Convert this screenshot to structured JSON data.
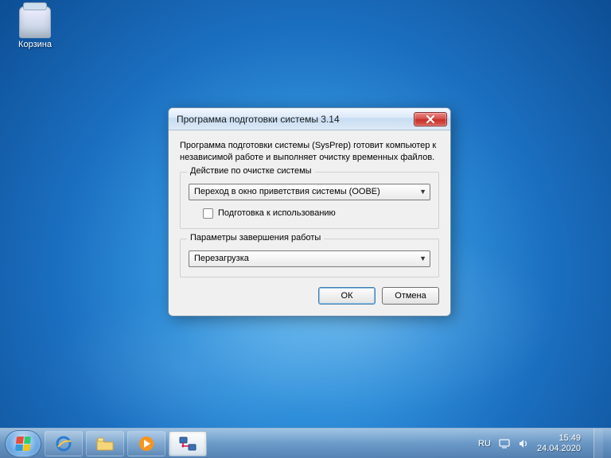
{
  "desktop": {
    "recycle_bin_label": "Корзина"
  },
  "dialog": {
    "title": "Программа подготовки системы 3.14",
    "description": "Программа подготовки системы (SysPrep) готовит компьютер к независимой работе и выполняет очистку временных файлов.",
    "group_cleanup_label": "Действие по очистке системы",
    "cleanup_action_value": "Переход в окно приветствия системы (OOBE)",
    "generalize_label": "Подготовка к использованию",
    "group_shutdown_label": "Параметры завершения работы",
    "shutdown_value": "Перезагрузка",
    "ok_label": "ОК",
    "cancel_label": "Отмена"
  },
  "taskbar": {
    "lang": "RU",
    "time": "15:49",
    "date": "24.04.2020"
  }
}
